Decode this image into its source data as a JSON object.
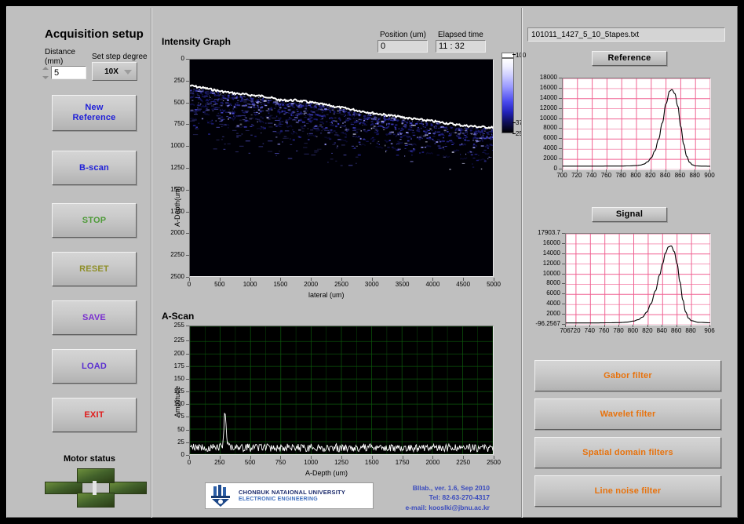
{
  "window": {
    "bg": "#bfbfbf"
  },
  "acquisition": {
    "title": "Acquisition setup",
    "distance": {
      "label_line1": "Distance",
      "label_line2": "(mm)",
      "value": "5"
    },
    "step_degree": {
      "label": "Set step degree",
      "value": "10X"
    },
    "buttons": [
      {
        "name": "new-reference",
        "label_line1": "New",
        "label_line2": "Reference",
        "color": "#2020d8"
      },
      {
        "name": "b-scan",
        "label_line1": "B-scan",
        "label_line2": "",
        "color": "#2020d8"
      },
      {
        "name": "stop",
        "label_line1": "STOP",
        "label_line2": "",
        "color": "#4f9b3a"
      },
      {
        "name": "reset",
        "label_line1": "RESET",
        "label_line2": "",
        "color": "#8f8f2a"
      },
      {
        "name": "save",
        "label_line1": "SAVE",
        "label_line2": "",
        "color": "#7a2fd0"
      },
      {
        "name": "load",
        "label_line1": "LOAD",
        "label_line2": "",
        "color": "#5b2fd0"
      },
      {
        "name": "exit",
        "label_line1": "EXIT",
        "label_line2": "",
        "color": "#e01b1b"
      }
    ],
    "motor_status_label": "Motor status"
  },
  "readouts": {
    "position": {
      "label": "Position (um)",
      "value": "0"
    },
    "elapsed": {
      "label": "Elapsed time",
      "value": "11 : 32"
    }
  },
  "intensity_graph": {
    "title": "Intensity Graph",
    "colorbar": {
      "top": "100",
      "mid": "37",
      "bottom": "25"
    }
  },
  "right_panel": {
    "filename": "101011_1427_5_10_5tapes.txt",
    "reference_button": "Reference",
    "signal_button": "Signal",
    "filters": [
      {
        "name": "gabor-filter",
        "label": "Gabor filter",
        "color": "#e8720c"
      },
      {
        "name": "wavelet-filter",
        "label": "Wavelet filter",
        "color": "#e8720c"
      },
      {
        "name": "spatial-domain-filters",
        "label": "Spatial domain filters",
        "color": "#e8720c"
      },
      {
        "name": "line-noise-filter",
        "label": "Line noise filter",
        "color": "#e8720c"
      }
    ]
  },
  "footer": {
    "logo_line1": "CHONBUK NATAIONAL UNIVERSITY",
    "logo_line2": "ELECTRONIC ENGINEERING",
    "line1": "BIlab., ver. 1.6, Sep 2010",
    "line2": "Tel: 82-63-270-4317",
    "line3": "e-mail: kooslki@jbnu.ac.kr"
  },
  "chart_data": [
    {
      "id": "intensity",
      "type": "heatmap",
      "title": "Intensity Graph",
      "xlabel": "lateral (um)",
      "ylabel": "A-Depth(um)",
      "xlim": [
        0,
        5000
      ],
      "ylim": [
        0,
        2500
      ],
      "xticks": [
        0,
        500,
        1000,
        1500,
        2000,
        2500,
        3000,
        3500,
        4000,
        4500,
        5000
      ],
      "yticks": [
        0,
        250,
        500,
        750,
        1000,
        1250,
        1500,
        1750,
        2000,
        2250,
        2500
      ],
      "grid": false,
      "colorbar": {
        "min": 25,
        "mid": 37,
        "max": 100,
        "colormap": "black-blue-white"
      },
      "description": "B-scan OCT cross-section: bright surface boundary sloping from ~300um depth at lateral 0 to ~800um at lateral 5000, with blue sub-surface tape layer speckle beneath it; remainder black background.",
      "surface_profile": {
        "lateral": [
          0,
          250,
          500,
          750,
          1000,
          1250,
          1500,
          1750,
          2000,
          2250,
          2500,
          2750,
          3000,
          3250,
          3500,
          3750,
          4000,
          4250,
          4500,
          4750,
          5000
        ],
        "depth": [
          300,
          330,
          365,
          390,
          410,
          425,
          470,
          470,
          495,
          525,
          555,
          585,
          615,
          640,
          665,
          690,
          710,
          735,
          760,
          775,
          785
        ]
      }
    },
    {
      "id": "a-scan",
      "type": "line",
      "title": "A-Scan",
      "xlabel": "A-Depth (um)",
      "ylabel": "Amplitude",
      "xlim": [
        0,
        2500
      ],
      "ylim": [
        0,
        255
      ],
      "xticks": [
        0,
        250,
        500,
        750,
        1000,
        1250,
        1500,
        1750,
        2000,
        2250,
        2500
      ],
      "yticks": [
        0,
        25,
        50,
        75,
        100,
        125,
        150,
        175,
        200,
        225,
        255
      ],
      "grid": true,
      "grid_color": "#0d5a0d",
      "trace_color": "#ffffff",
      "background": "#000000",
      "description": "Noisy A-line with baseline amplitude ~8-20 plus a single sharp peak near A-Depth 290um reaching ~77.",
      "peak": {
        "x": 290,
        "y": 77
      },
      "baseline_mean": 12
    },
    {
      "id": "reference-spectrum",
      "type": "line",
      "title": "Reference",
      "xlabel": "",
      "ylabel": "",
      "xlim": [
        700,
        900
      ],
      "ylim": [
        0,
        18000
      ],
      "xticks": [
        700,
        720,
        740,
        760,
        780,
        800,
        820,
        840,
        860,
        880,
        900
      ],
      "yticks": [
        0,
        2000,
        4000,
        6000,
        8000,
        10000,
        12000,
        14000,
        16000,
        18000
      ],
      "grid": true,
      "grid_color": "#f06292",
      "trace_color": "#000000",
      "x": [
        700,
        720,
        740,
        760,
        780,
        790,
        800,
        805,
        810,
        815,
        820,
        825,
        830,
        835,
        840,
        845,
        848,
        852,
        856,
        860,
        864,
        868,
        872,
        876,
        880,
        890,
        900
      ],
      "y": [
        650,
        650,
        650,
        660,
        670,
        700,
        760,
        850,
        1050,
        1500,
        2300,
        3700,
        6000,
        9200,
        13000,
        15500,
        15800,
        15000,
        12500,
        8500,
        5000,
        2600,
        1400,
        900,
        700,
        650,
        640
      ]
    },
    {
      "id": "signal-spectrum",
      "type": "line",
      "title": "Signal",
      "xlabel": "",
      "ylabel": "",
      "xlim": [
        706,
        906
      ],
      "ylim": [
        -96.2567,
        17903.7
      ],
      "xticks": [
        706,
        720,
        740,
        760,
        780,
        800,
        820,
        840,
        860,
        880,
        906
      ],
      "ytick_labels": [
        "17903.7",
        "16000",
        "14000",
        "12000",
        "10000",
        "8000",
        "6000",
        "4000",
        "2000",
        "-96.2567"
      ],
      "grid": true,
      "grid_color": "#f06292",
      "trace_color": "#000000",
      "x": [
        706,
        730,
        750,
        765,
        780,
        790,
        800,
        806,
        812,
        818,
        824,
        830,
        836,
        840,
        844,
        848,
        852,
        856,
        860,
        864,
        868,
        872,
        876,
        880,
        890,
        906
      ],
      "y": [
        260,
        260,
        265,
        290,
        330,
        420,
        640,
        900,
        1400,
        2400,
        4100,
        6600,
        9800,
        12000,
        14100,
        15300,
        15500,
        14400,
        12000,
        8400,
        4800,
        2400,
        1200,
        700,
        380,
        290
      ]
    }
  ]
}
